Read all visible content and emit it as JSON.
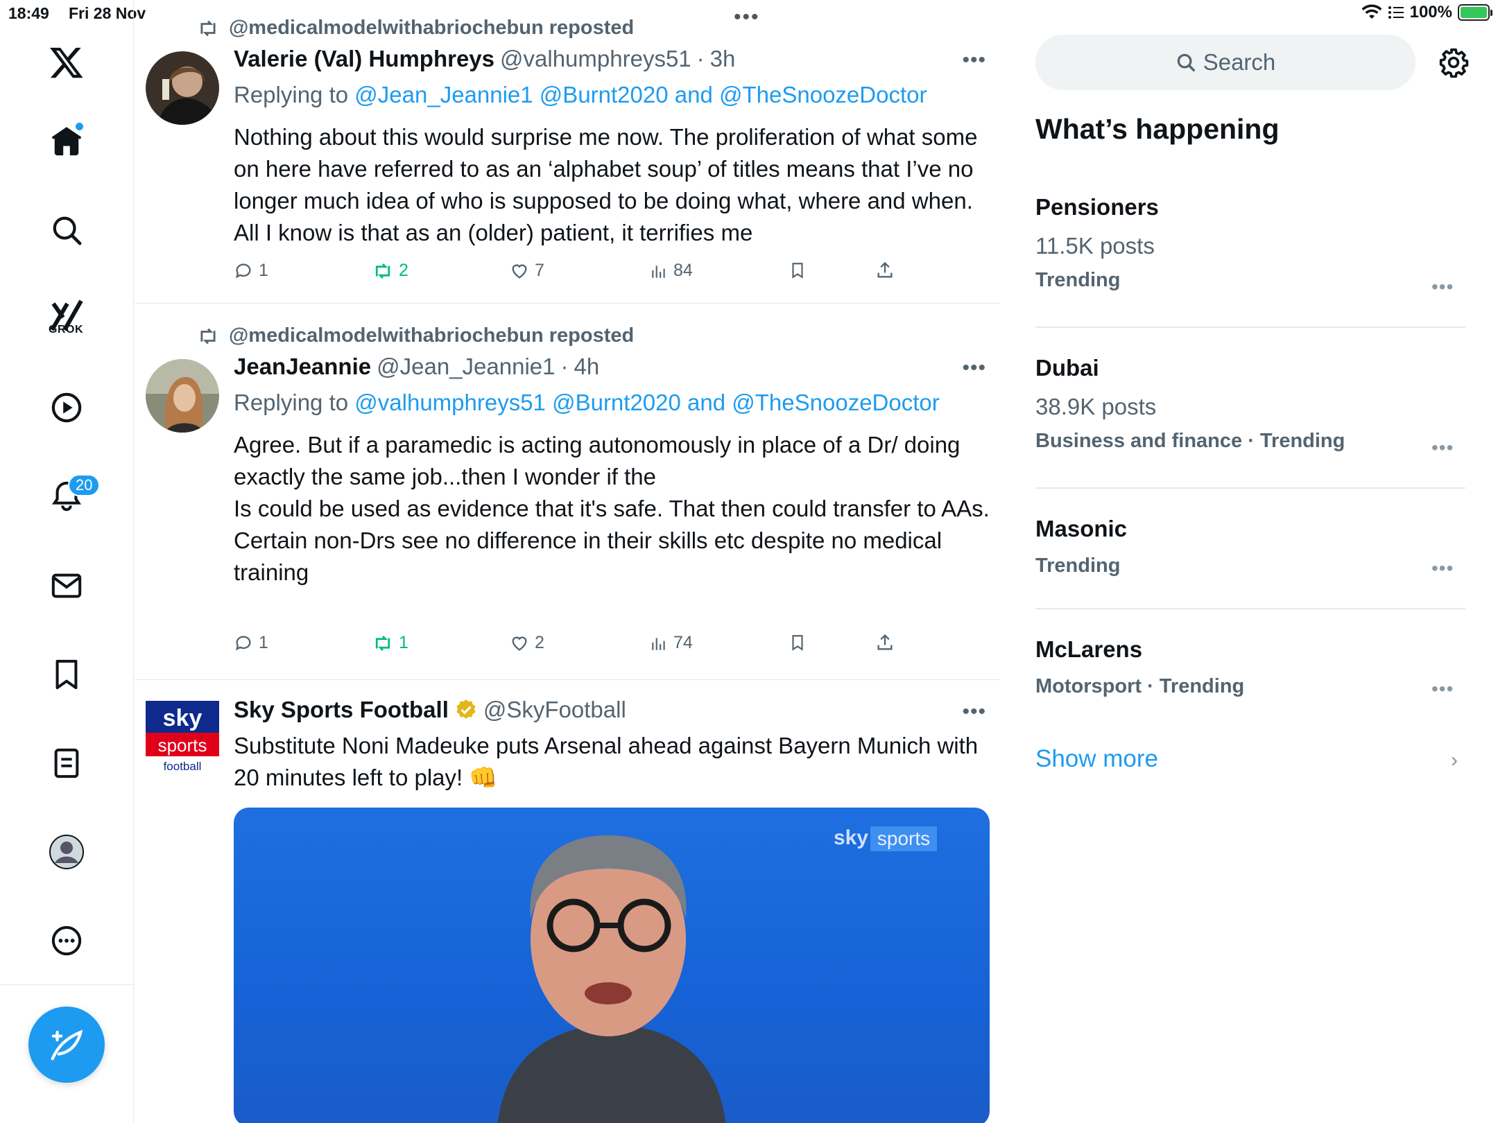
{
  "status_bar": {
    "time": "18:49",
    "date": "Fri 28 Nov",
    "battery": "100%"
  },
  "nav": {
    "grok_label": "GROK",
    "notifications_count": "20"
  },
  "feed": {
    "tweets": [
      {
        "repost_label": "@medicalmodelwithabriochebun reposted",
        "name": "Valerie (Val) Humphreys",
        "handle": "@valhumphreys51",
        "time": "3h",
        "replying_prefix": "Replying to",
        "replying_to": "@Jean_Jeannie1 @Burnt2020 and @TheSnoozeDoctor",
        "text": "Nothing about this would surprise me now. The proliferation of what some on here have referred to as an ‘alphabet soup’ of titles means that I’ve no longer much idea of who is supposed to be doing what, where and when. All I know is that as an (older) patient, it terrifies me",
        "replies": "1",
        "reposts": "2",
        "likes": "7",
        "views": "84"
      },
      {
        "repost_label": "@medicalmodelwithabriochebun reposted",
        "name": "JeanJeannie",
        "handle": "@Jean_Jeannie1",
        "time": "4h",
        "replying_prefix": "Replying to",
        "replying_to": "@valhumphreys51 @Burnt2020 and @TheSnoozeDoctor",
        "text": "Agree. But if a paramedic is acting autonomously in place of a Dr/ doing exactly the same job...then I wonder if the\nIs could be used as evidence that it's safe. That then could transfer to AAs.\nCertain non-Drs see no difference in their skills etc despite no medical training",
        "replies": "1",
        "reposts": "1",
        "likes": "2",
        "views": "74"
      },
      {
        "name": "Sky Sports Football",
        "handle": "@SkyFootball",
        "text": "Substitute Noni Madeuke puts Arsenal ahead against Bayern Munich with 20 minutes left to play! 👊",
        "logo_top": "sky",
        "logo_mid": "sports",
        "logo_bottom": "football",
        "media_watermark_sky": "sky",
        "media_watermark_sports": "sports"
      }
    ]
  },
  "sidebar": {
    "search_placeholder": "Search",
    "title": "What’s happening",
    "trends": [
      {
        "name": "Pensioners",
        "posts": "11.5K posts",
        "meta": "Trending"
      },
      {
        "name": "Dubai",
        "posts": "38.9K posts",
        "meta": "Business and finance · Trending"
      },
      {
        "name": "Masonic",
        "meta": "Trending"
      },
      {
        "name": "McLarens",
        "meta": "Motorsport · Trending"
      }
    ],
    "show_more": "Show more"
  },
  "colors": {
    "accent": "#1d9bf0",
    "repost_green": "#00ba7c",
    "muted": "#536471"
  }
}
